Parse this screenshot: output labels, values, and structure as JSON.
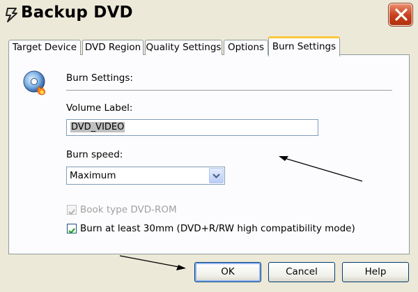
{
  "window": {
    "title": "Backup DVD"
  },
  "icons": {
    "title": "dvd-backup-icon",
    "close": "close-icon",
    "section": "burn-disc-icon",
    "dropdown": "chevron-down-icon",
    "check": "checkmark-icon"
  },
  "colors": {
    "close_button": "#c6401b",
    "active_tab_accent": "#ffc73c",
    "panel_bg": "#fcfcfe",
    "window_bg": "#ece9d8"
  },
  "tabs": [
    {
      "label": "Target Device",
      "active": false
    },
    {
      "label": "DVD Region",
      "active": false
    },
    {
      "label": "Quality Settings",
      "active": false
    },
    {
      "label": "Options",
      "active": false
    },
    {
      "label": "Burn Settings",
      "active": true
    }
  ],
  "panel": {
    "heading": "Burn Settings:",
    "volume_label": {
      "label": "Volume Label:",
      "value": "DVD_VIDEO"
    },
    "burn_speed": {
      "label": "Burn speed:",
      "selected": "Maximum"
    },
    "book_type": {
      "label": "Book type DVD-ROM",
      "checked": true,
      "enabled": false
    },
    "burn_30mm": {
      "label": "Burn at least 30mm (DVD+R/RW high compatibility mode)",
      "checked": true,
      "enabled": true
    }
  },
  "buttons": {
    "ok": "OK",
    "cancel": "Cancel",
    "help": "Help"
  }
}
